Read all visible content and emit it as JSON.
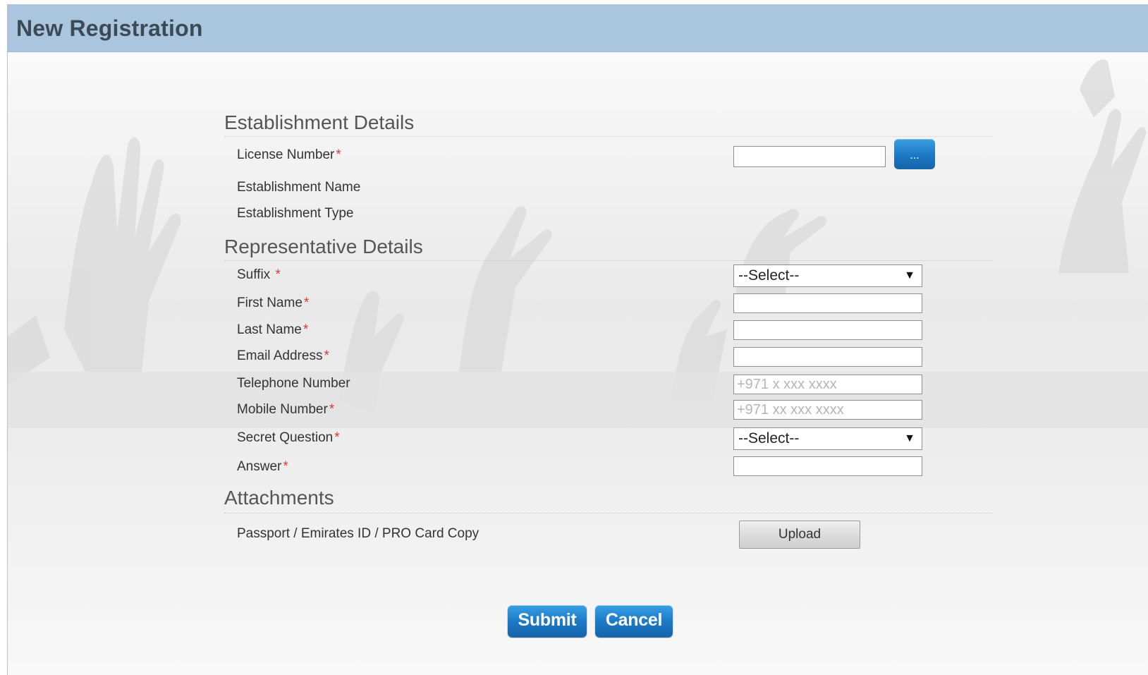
{
  "header": {
    "title": "New Registration"
  },
  "sections": {
    "establishment": {
      "title": "Establishment Details",
      "license_label": "License Number",
      "lookup_label": "...",
      "name_label": "Establishment Name",
      "type_label": "Establishment Type"
    },
    "representative": {
      "title": "Representative Details",
      "suffix_label": "Suffix",
      "suffix_value": "--Select--",
      "first_name_label": "First Name",
      "last_name_label": "Last Name",
      "email_label": "Email Address",
      "telephone_label": "Telephone Number",
      "telephone_placeholder": "+971 x xxx xxxx",
      "mobile_label": "Mobile Number",
      "mobile_placeholder": "+971 xx xxx xxxx",
      "secret_question_label": "Secret Question",
      "secret_question_value": "--Select--",
      "answer_label": "Answer"
    },
    "attachments": {
      "title": "Attachments",
      "document_label": "Passport / Emirates ID / PRO Card Copy",
      "upload_label": "Upload"
    }
  },
  "required_marker": "*",
  "actions": {
    "submit_label": "Submit",
    "cancel_label": "Cancel"
  },
  "colors": {
    "header_bg": "#a9c6de",
    "primary_button": "#1c7ac7",
    "required": "#d43b3b"
  }
}
